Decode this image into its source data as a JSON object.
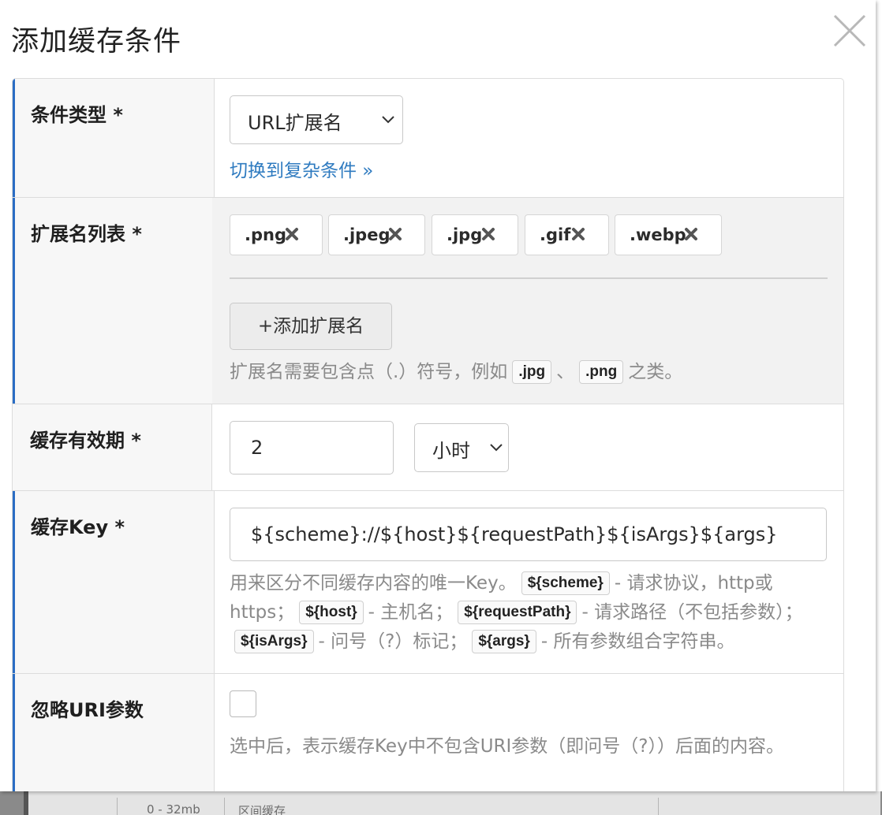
{
  "dialog": {
    "title": "添加缓存条件",
    "close_icon": "close-icon"
  },
  "condition_type": {
    "label": "条件类型 *",
    "selected": "URL扩展名",
    "switch_link": "切换到复杂条件 »"
  },
  "extensions": {
    "label": "扩展名列表 *",
    "items": [
      ".png",
      ".jpeg",
      ".jpg",
      ".gif",
      ".webp"
    ],
    "add_button": "+添加扩展名",
    "help_prefix": "扩展名需要包含点（.）符号，例如",
    "help_example_1": ".jpg",
    "help_sep": "、",
    "help_example_2": ".png",
    "help_suffix": "之类。"
  },
  "ttl": {
    "label": "缓存有效期 *",
    "value": "2",
    "unit": "小时"
  },
  "cache_key": {
    "label": "缓存Key *",
    "value": "${scheme}://${host}${requestPath}${isArgs}${args}",
    "help_intro": "用来区分不同缓存内容的唯一Key。",
    "var_scheme": "${scheme}",
    "desc_scheme": "- 请求协议，http或https；",
    "var_host": "${host}",
    "desc_host": "- 主机名；",
    "var_request_path": "${requestPath}",
    "desc_request_path": "- 请求路径（不包括参数）；",
    "var_is_args": "${isArgs}",
    "desc_is_args": "- 问号（?）标记；",
    "var_args": "${args}",
    "desc_args": "- 所有参数组合字符串。"
  },
  "ignore_uri_args": {
    "label": "忽略URI参数",
    "checked": false,
    "help": "选中后，表示缓存Key中不包含URI参数（即问号（?））后面的内容。"
  },
  "background_page": {
    "cell_1": "0 - 32mb",
    "cell_2": "区间缓存"
  },
  "colors": {
    "accent_bar": "#2a6dc4",
    "link": "#2f7bc0",
    "help_text": "#8a8a8a"
  }
}
